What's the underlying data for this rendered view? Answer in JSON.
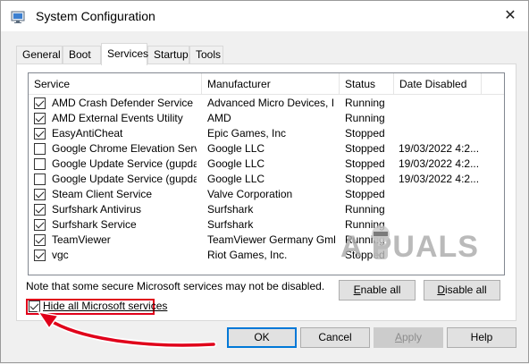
{
  "window": {
    "title": "System Configuration"
  },
  "titlebar": {
    "close_glyph": "✕"
  },
  "tabs": [
    {
      "label": "General"
    },
    {
      "label": "Boot"
    },
    {
      "label": "Services"
    },
    {
      "label": "Startup"
    },
    {
      "label": "Tools"
    }
  ],
  "active_tab": "Services",
  "services": {
    "columns": {
      "service": "Service",
      "manufacturer": "Manufacturer",
      "status": "Status",
      "date_disabled": "Date Disabled"
    },
    "rows": [
      {
        "checked": true,
        "service": "AMD Crash Defender Service",
        "manufacturer": "Advanced Micro Devices, I...",
        "status": "Running",
        "date": ""
      },
      {
        "checked": true,
        "service": "AMD External Events Utility",
        "manufacturer": "AMD",
        "status": "Running",
        "date": ""
      },
      {
        "checked": true,
        "service": "EasyAntiCheat",
        "manufacturer": "Epic Games, Inc",
        "status": "Stopped",
        "date": ""
      },
      {
        "checked": false,
        "service": "Google Chrome Elevation Servic...",
        "manufacturer": "Google LLC",
        "status": "Stopped",
        "date": "19/03/2022 4:2..."
      },
      {
        "checked": false,
        "service": "Google Update Service (gupdate)",
        "manufacturer": "Google LLC",
        "status": "Stopped",
        "date": "19/03/2022 4:2..."
      },
      {
        "checked": false,
        "service": "Google Update Service (gupdatem)",
        "manufacturer": "Google LLC",
        "status": "Stopped",
        "date": "19/03/2022 4:2..."
      },
      {
        "checked": true,
        "service": "Steam Client Service",
        "manufacturer": "Valve Corporation",
        "status": "Stopped",
        "date": ""
      },
      {
        "checked": true,
        "service": "Surfshark Antivirus",
        "manufacturer": "Surfshark",
        "status": "Running",
        "date": ""
      },
      {
        "checked": true,
        "service": "Surfshark Service",
        "manufacturer": "Surfshark",
        "status": "Running",
        "date": ""
      },
      {
        "checked": true,
        "service": "TeamViewer",
        "manufacturer": "TeamViewer Germany GmbH",
        "status": "Running",
        "date": ""
      },
      {
        "checked": true,
        "service": "vgc",
        "manufacturer": "Riot Games, Inc.",
        "status": "Stopped",
        "date": ""
      }
    ]
  },
  "note": "Note that some secure Microsoft services may not be disabled.",
  "enable_all": {
    "mnemonic": "E",
    "rest": "nable all"
  },
  "disable_all": {
    "mnemonic": "D",
    "rest": "isable all"
  },
  "hide_ms": {
    "label": "Hide all Microsoft services",
    "checked": true
  },
  "buttons": {
    "ok": "OK",
    "cancel": "Cancel",
    "apply": {
      "mnemonic": "A",
      "rest": "pply"
    },
    "help": "Help"
  },
  "watermark": {
    "text": "A  PUALS"
  },
  "colors": {
    "highlight": "#e0001a",
    "accent": "#0078d7"
  }
}
